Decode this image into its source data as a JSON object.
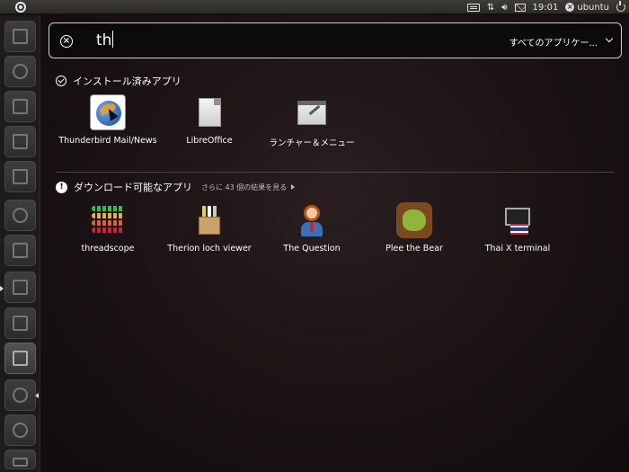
{
  "top_panel": {
    "clock": "19:01",
    "user": "ubuntu",
    "icons": [
      "keyboard-icon",
      "network-icon",
      "volume-icon",
      "mail-icon",
      "user-icon",
      "power-icon"
    ]
  },
  "launcher": {
    "items": [
      "home-folder",
      "firefox",
      "writer",
      "calc",
      "impress",
      "software-center",
      "ubuntu-one",
      "workspaces",
      "screenshot",
      "window-manager",
      "zoom",
      "cd-burner",
      "trash"
    ]
  },
  "search": {
    "query": "th",
    "filter": "すべてのアプリケー..."
  },
  "installed": {
    "title": "インストール済みアプリ",
    "apps": [
      {
        "name": "Thunderbird Mail/News",
        "icon": "thunderbird-icon"
      },
      {
        "name": "LibreOffice",
        "icon": "libreoffice-icon"
      },
      {
        "name": "ランチャー＆メニュー",
        "icon": "launcher-menu-icon"
      }
    ]
  },
  "downloadable": {
    "title": "ダウンロード可能なアプリ",
    "more": "さらに 43 個の結果を見る",
    "apps": [
      {
        "name": "threadscope",
        "icon": "threadscope-icon"
      },
      {
        "name": "Therion loch viewer",
        "icon": "therion-icon"
      },
      {
        "name": "The Question",
        "icon": "the-question-icon"
      },
      {
        "name": "Plee the Bear",
        "icon": "plee-the-bear-icon"
      },
      {
        "name": "Thai X terminal",
        "icon": "thai-terminal-icon"
      }
    ]
  }
}
